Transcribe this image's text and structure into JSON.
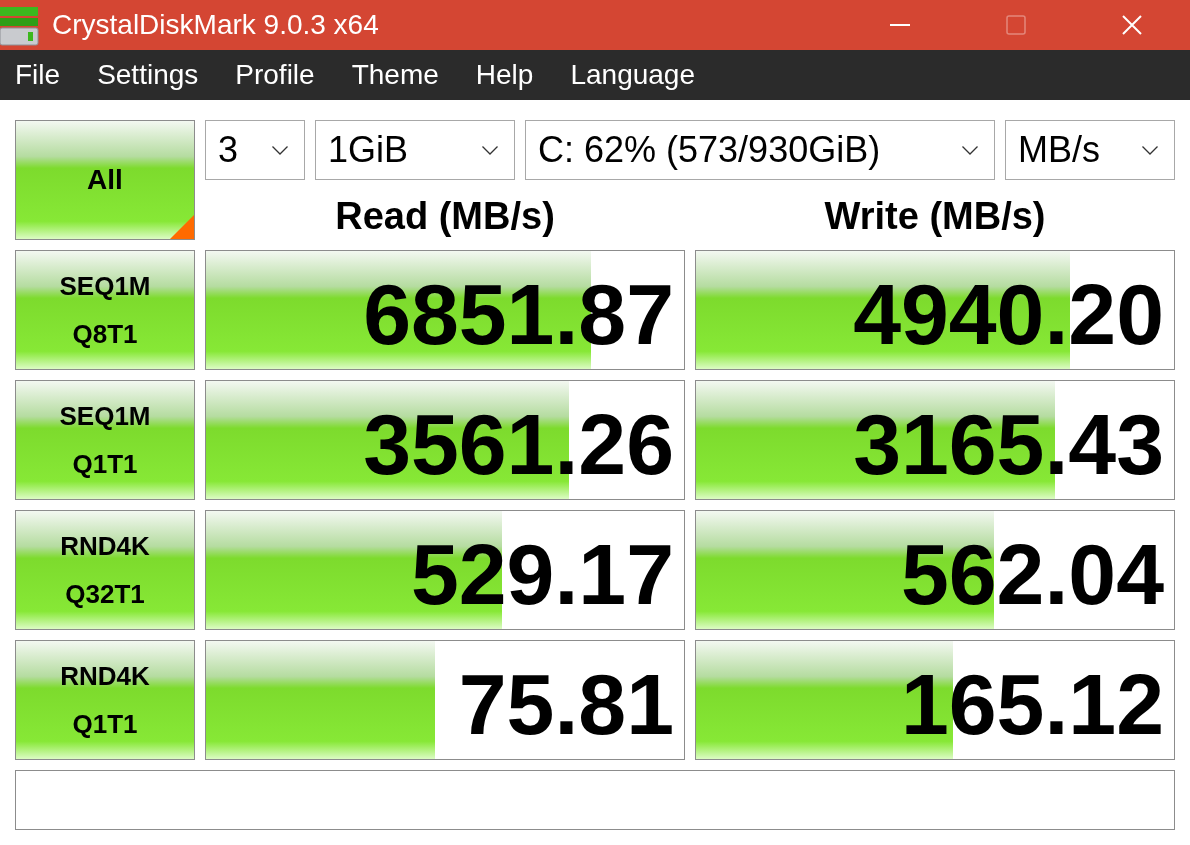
{
  "window": {
    "title": "CrystalDiskMark 9.0.3 x64",
    "controls": [
      {
        "kind": "minimize",
        "disabled": false
      },
      {
        "kind": "maximize",
        "disabled": true
      },
      {
        "kind": "close",
        "disabled": false
      }
    ]
  },
  "menu": [
    "File",
    "Settings",
    "Profile",
    "Theme",
    "Help",
    "Language"
  ],
  "all_button": "All",
  "dropdowns": [
    {
      "value": "3"
    },
    {
      "value": "1GiB"
    },
    {
      "value": "C: 62% (573/930GiB)"
    },
    {
      "value": "MB/s"
    }
  ],
  "columns": [
    "Read (MB/s)",
    "Write (MB/s)"
  ],
  "tests": [
    {
      "label": [
        "SEQ1M",
        "Q8T1"
      ],
      "read": {
        "value": "6851.87",
        "level": 0.805
      },
      "write": {
        "value": "4940.20",
        "level": 0.783
      }
    },
    {
      "label": [
        "SEQ1M",
        "Q1T1"
      ],
      "read": {
        "value": "3561.26",
        "level": 0.76
      },
      "write": {
        "value": "3165.43",
        "level": 0.751
      }
    },
    {
      "label": [
        "RND4K",
        "Q32T1"
      ],
      "read": {
        "value": "529.17",
        "level": 0.619
      },
      "write": {
        "value": "562.04",
        "level": 0.623
      }
    },
    {
      "label": [
        "RND4K",
        "Q1T1"
      ],
      "read": {
        "value": "75.81",
        "level": 0.479
      },
      "write": {
        "value": "165.12",
        "level": 0.537
      }
    }
  ]
}
